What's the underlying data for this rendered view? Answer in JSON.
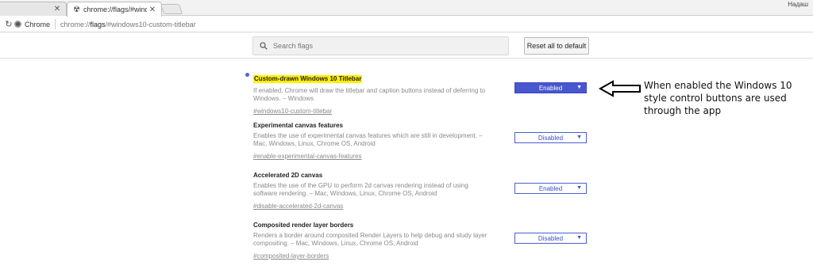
{
  "browser": {
    "tabs": [
      {
        "title": "",
        "active": false
      },
      {
        "title": "chrome://flags/#window",
        "active": true
      }
    ],
    "corner_text": "Надаш",
    "site_chip": "Chrome",
    "url_prefix": "chrome://",
    "url_host": "flags",
    "url_rest": "/#windows10-custom-titlebar"
  },
  "header": {
    "search_placeholder": "Search flags",
    "reset_label": "Reset all to default"
  },
  "experiments": [
    {
      "title": "Custom-drawn Windows 10 Titlebar",
      "highlighted": true,
      "description": "If enabled, Chrome will draw the titlebar and caption buttons instead of deferring to Windows. – Windows",
      "link": "#windows10-custom-titlebar",
      "value": "Enabled"
    },
    {
      "title": "Experimental canvas features",
      "highlighted": false,
      "description": "Enables the use of experimental canvas features which are still in development. – Mac, Windows, Linux, Chrome OS, Android",
      "link": "#enable-experimental-canvas-features",
      "value": "Disabled"
    },
    {
      "title": "Accelerated 2D canvas",
      "highlighted": false,
      "description": "Enables the use of the GPU to perform 2d canvas rendering instead of using software rendering. – Mac, Windows, Linux, Chrome OS, Android",
      "link": "#disable-accelerated-2d-canvas",
      "value": "Enabled"
    },
    {
      "title": "Composited render layer borders",
      "highlighted": false,
      "description": "Renders a border around composited Render Layers to help debug and study layer compositing. – Mac, Windows, Linux, Chrome OS, Android",
      "link": "#composited-layer-borders",
      "value": "Disabled"
    }
  ],
  "annotation": {
    "text": "When enabled the  Windows 10 style control buttons are used through the app"
  },
  "colors": {
    "accent": "#4856cf",
    "highlight": "#ffef00",
    "dot": "#4a68d8"
  }
}
